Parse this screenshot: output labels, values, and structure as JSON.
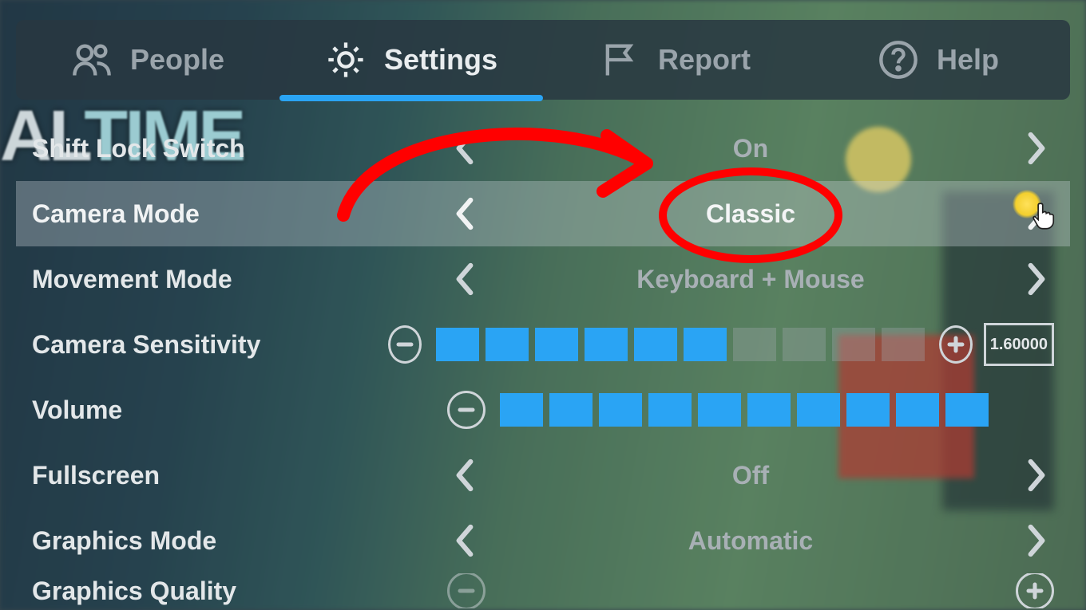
{
  "tabs": {
    "people": "People",
    "settings": "Settings",
    "report": "Report",
    "help": "Help",
    "active": "settings"
  },
  "settings": {
    "shift_lock": {
      "label": "Shift Lock Switch",
      "value": "On"
    },
    "camera_mode": {
      "label": "Camera Mode",
      "value": "Classic"
    },
    "movement_mode": {
      "label": "Movement Mode",
      "value": "Keyboard + Mouse"
    },
    "camera_sensitivity": {
      "label": "Camera Sensitivity",
      "filled": 6,
      "total": 10,
      "numeric": "1.60000"
    },
    "volume": {
      "label": "Volume",
      "filled": 10,
      "total": 10
    },
    "fullscreen": {
      "label": "Fullscreen",
      "value": "Off"
    },
    "graphics_mode": {
      "label": "Graphics Mode",
      "value": "Automatic"
    },
    "graphics_quality": {
      "label": "Graphics Quality"
    }
  },
  "colors": {
    "accent": "#2aa4f4",
    "annotation": "#ff0000"
  },
  "background_logo": {
    "part1": "AL",
    "part2": "TIME"
  }
}
